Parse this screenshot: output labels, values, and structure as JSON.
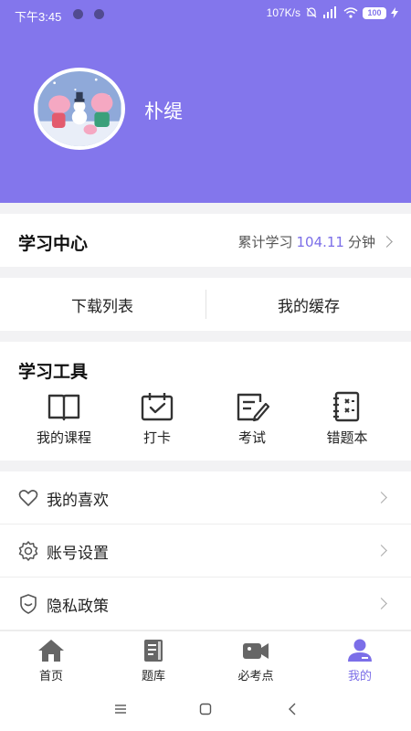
{
  "status_bar": {
    "time": "下午3:45",
    "network_speed": "107K/s",
    "battery": "100"
  },
  "profile": {
    "username": "朴缇",
    "avatar_icon": "cartoon-pig-snowman-avatar"
  },
  "study_center": {
    "title": "学习中心",
    "stats_prefix": "累计学习",
    "minutes": "104.11",
    "stats_suffix": "分钟"
  },
  "downloads": {
    "list_label": "下载列表",
    "cache_label": "我的缓存"
  },
  "tools": {
    "title": "学习工具",
    "items": [
      {
        "label": "我的课程",
        "icon": "book-icon"
      },
      {
        "label": "打卡",
        "icon": "calendar-check-icon"
      },
      {
        "label": "考试",
        "icon": "exam-edit-icon"
      },
      {
        "label": "错题本",
        "icon": "notebook-icon"
      }
    ]
  },
  "menu": {
    "items": [
      {
        "label": "我的喜欢",
        "icon": "heart-icon"
      },
      {
        "label": "账号设置",
        "icon": "gear-icon"
      },
      {
        "label": "隐私政策",
        "icon": "shield-icon"
      }
    ]
  },
  "tabbar": {
    "items": [
      {
        "label": "首页",
        "icon": "home-icon"
      },
      {
        "label": "题库",
        "icon": "question-bank-icon"
      },
      {
        "label": "必考点",
        "icon": "video-icon"
      },
      {
        "label": "我的",
        "icon": "user-icon",
        "active": true
      }
    ]
  },
  "colors": {
    "accent": "#8376ec",
    "active_tab": "#7b6ee8",
    "inactive_tab": "#666666"
  }
}
